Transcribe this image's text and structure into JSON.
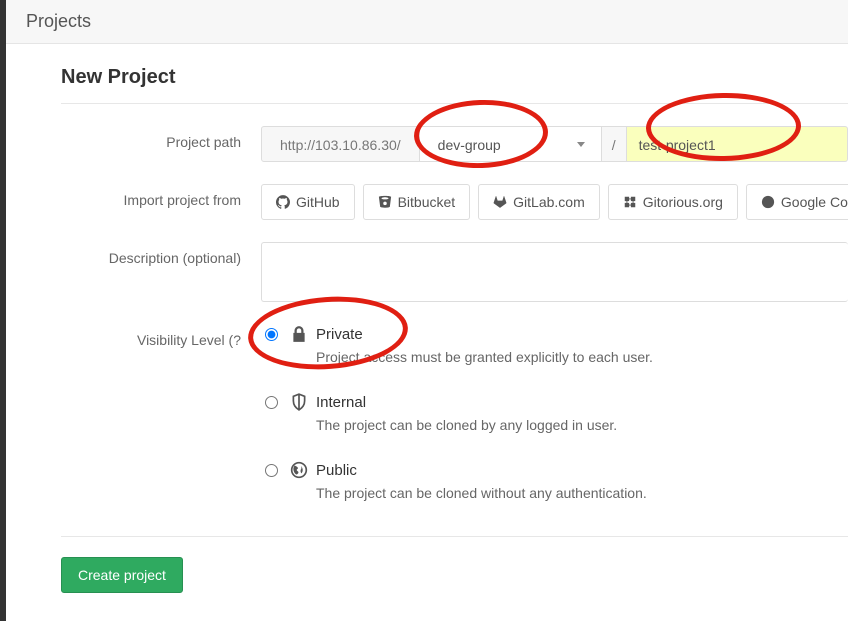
{
  "header": {
    "title": "Projects"
  },
  "panel": {
    "title": "New Project"
  },
  "labels": {
    "project_path": "Project path",
    "import_from": "Import project from",
    "description": "Description (optional)",
    "visibility": "Visibility Level (?"
  },
  "path": {
    "host": "http://103.10.86.30/",
    "group": "dev-group",
    "slash": "/",
    "name": "test-project1"
  },
  "import_options": [
    {
      "label": "GitHub",
      "icon": "github"
    },
    {
      "label": "Bitbucket",
      "icon": "bitbucket"
    },
    {
      "label": "GitLab.com",
      "icon": "gitlab"
    },
    {
      "label": "Gitorious.org",
      "icon": "gitorious"
    },
    {
      "label": "Google Code",
      "icon": "googlecode"
    }
  ],
  "visibility": {
    "options": [
      {
        "value": "private",
        "name": "Private",
        "desc": "Project access must be granted explicitly to each user.",
        "checked": true
      },
      {
        "value": "internal",
        "name": "Internal",
        "desc": "The project can be cloned by any logged in user.",
        "checked": false
      },
      {
        "value": "public",
        "name": "Public",
        "desc": "The project can be cloned without any authentication.",
        "checked": false
      }
    ]
  },
  "buttons": {
    "create": "Create project"
  }
}
